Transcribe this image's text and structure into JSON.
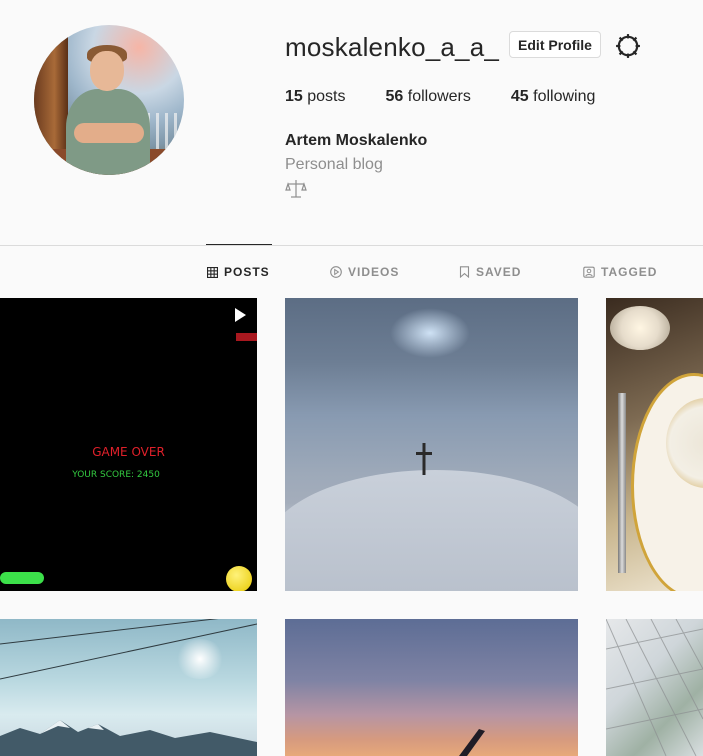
{
  "profile": {
    "username": "moskalenko_a_a_",
    "edit_button": "Edit Profile",
    "settings_icon": "gear-icon",
    "full_name": "Artem Moskalenko",
    "bio": "Personal blog",
    "bio_emoji": "balance-scale-icon",
    "stats": {
      "posts_count": "15",
      "posts_label": "posts",
      "followers_count": "56",
      "followers_label": "followers",
      "following_count": "45",
      "following_label": "following"
    }
  },
  "tabs": [
    {
      "label": "POSTS",
      "icon": "grid-icon",
      "active": true
    },
    {
      "label": "VIDEOS",
      "icon": "play-circle-icon",
      "active": false
    },
    {
      "label": "SAVED",
      "icon": "bookmark-icon",
      "active": false
    },
    {
      "label": "TAGGED",
      "icon": "tag-user-icon",
      "active": false
    }
  ],
  "posts": [
    {
      "kind": "video",
      "game_over": "GAME OVER",
      "score": "YOUR SCORE: 2450"
    },
    {
      "kind": "photo"
    },
    {
      "kind": "photo"
    },
    {
      "kind": "photo"
    },
    {
      "kind": "photo"
    },
    {
      "kind": "photo"
    }
  ],
  "colors": {
    "background": "#fafafa",
    "text": "#262626",
    "muted": "#8e8e8e",
    "divider": "#dbdbdb"
  }
}
